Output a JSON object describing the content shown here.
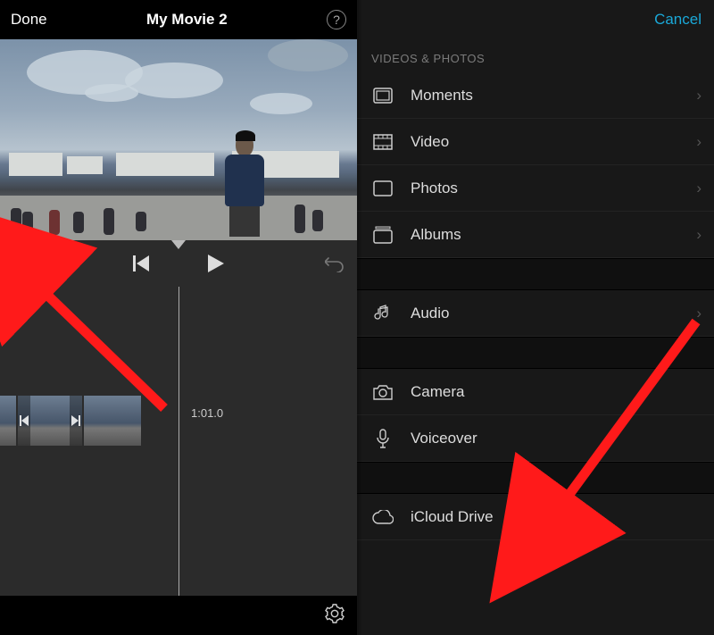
{
  "editor": {
    "done_label": "Done",
    "title": "My Movie 2",
    "help_label": "?",
    "add_label": "+",
    "timecode": "1:01.0"
  },
  "browser": {
    "cancel_label": "Cancel",
    "section_videos_photos": "VIDEOS & PHOTOS",
    "items": {
      "moments": "Moments",
      "video": "Video",
      "photos": "Photos",
      "albums": "Albums",
      "audio": "Audio",
      "camera": "Camera",
      "voiceover": "Voiceover",
      "icloud": "iCloud Drive"
    }
  }
}
